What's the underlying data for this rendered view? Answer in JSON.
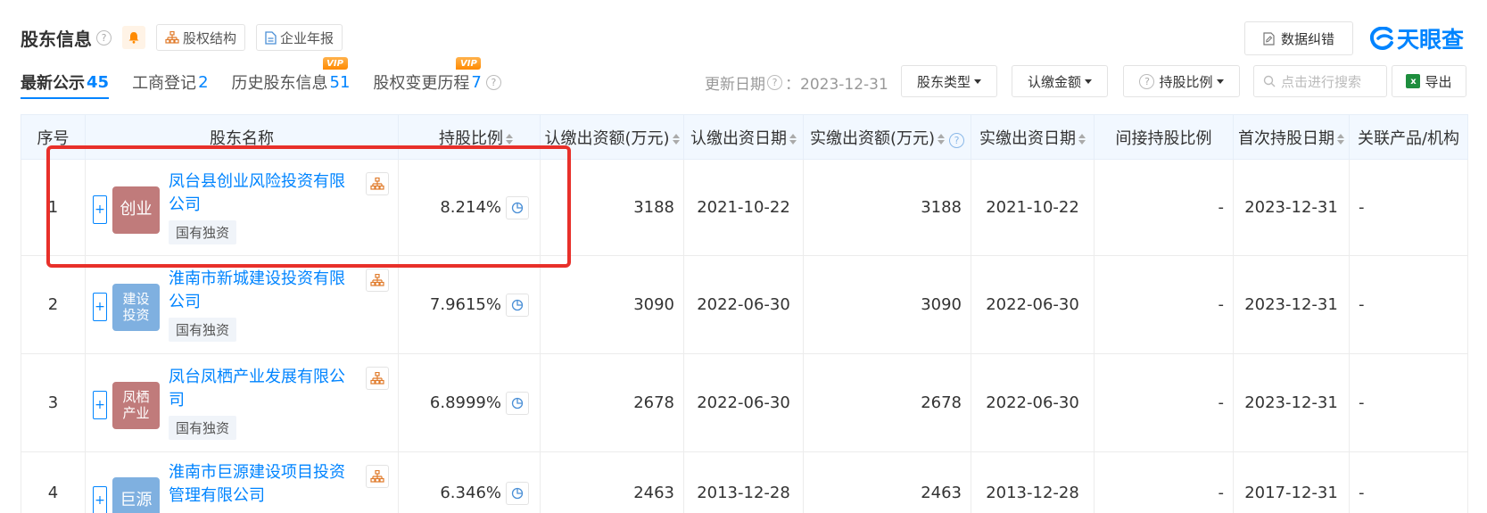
{
  "header": {
    "title": "股东信息",
    "equity_structure": "股权结构",
    "annual_report": "企业年报",
    "report_error": "数据纠错",
    "logo_text": "天眼查"
  },
  "tabs": [
    {
      "label": "最新公示",
      "count": "45",
      "active": true
    },
    {
      "label": "工商登记",
      "count": "2",
      "active": false
    },
    {
      "label": "历史股东信息",
      "count": "51",
      "vip": "VIP",
      "active": false
    },
    {
      "label": "股权变更历程",
      "count": "7",
      "vip": "VIP",
      "active": false
    }
  ],
  "toolbar": {
    "update_label": "更新日期",
    "update_date": "：2023-12-31",
    "shareholder_type": "股东类型",
    "subscribed_amount": "认缴金额",
    "holding_ratio": "持股比例",
    "search_placeholder": "点击进行搜索",
    "export": "导出"
  },
  "table": {
    "headers": {
      "index": "序号",
      "name": "股东名称",
      "ratio": "持股比例",
      "subscribed": "认缴出资额(万元)",
      "subscribed_date": "认缴出资日期",
      "paid": "实缴出资额(万元)",
      "paid_date": "实缴出资日期",
      "indirect": "间接持股比例",
      "first_date": "首次持股日期",
      "related": "关联产品/机构"
    },
    "rows": [
      {
        "index": "1",
        "avatar": "创业",
        "avatar_color": "#c07b7b",
        "name": "凤台县创业风险投资有限公司",
        "tag": "国有独资",
        "ratio": "8.214%",
        "subscribed": "3188",
        "subscribed_date": "2021-10-22",
        "paid": "3188",
        "paid_date": "2021-10-22",
        "indirect": "-",
        "first_date": "2023-12-31",
        "related": "-"
      },
      {
        "index": "2",
        "avatar": "建设\n投资",
        "avatar_color": "#7fb0e0",
        "name": "淮南市新城建设投资有限公司",
        "tag": "国有独资",
        "ratio": "7.9615%",
        "subscribed": "3090",
        "subscribed_date": "2022-06-30",
        "paid": "3090",
        "paid_date": "2022-06-30",
        "indirect": "-",
        "first_date": "2023-12-31",
        "related": "-"
      },
      {
        "index": "3",
        "avatar": "凤栖\n产业",
        "avatar_color": "#c07b7b",
        "name": "凤台凤栖产业发展有限公司",
        "tag": "国有独资",
        "ratio": "6.8999%",
        "subscribed": "2678",
        "subscribed_date": "2022-06-30",
        "paid": "2678",
        "paid_date": "2022-06-30",
        "indirect": "-",
        "first_date": "2023-12-31",
        "related": "-"
      },
      {
        "index": "4",
        "avatar": "巨源",
        "avatar_color": "#7fb0e0",
        "name": "淮南市巨源建设项目投资管理有限公司",
        "tag": "",
        "ratio": "6.346%",
        "subscribed": "2463",
        "subscribed_date": "2013-12-28",
        "paid": "2463",
        "paid_date": "2013-12-28",
        "indirect": "-",
        "first_date": "2017-12-31",
        "related": "-"
      }
    ]
  },
  "colors": {
    "accent": "#0084ff",
    "highlight": "#e8302a",
    "vip": "#ff8a00"
  }
}
